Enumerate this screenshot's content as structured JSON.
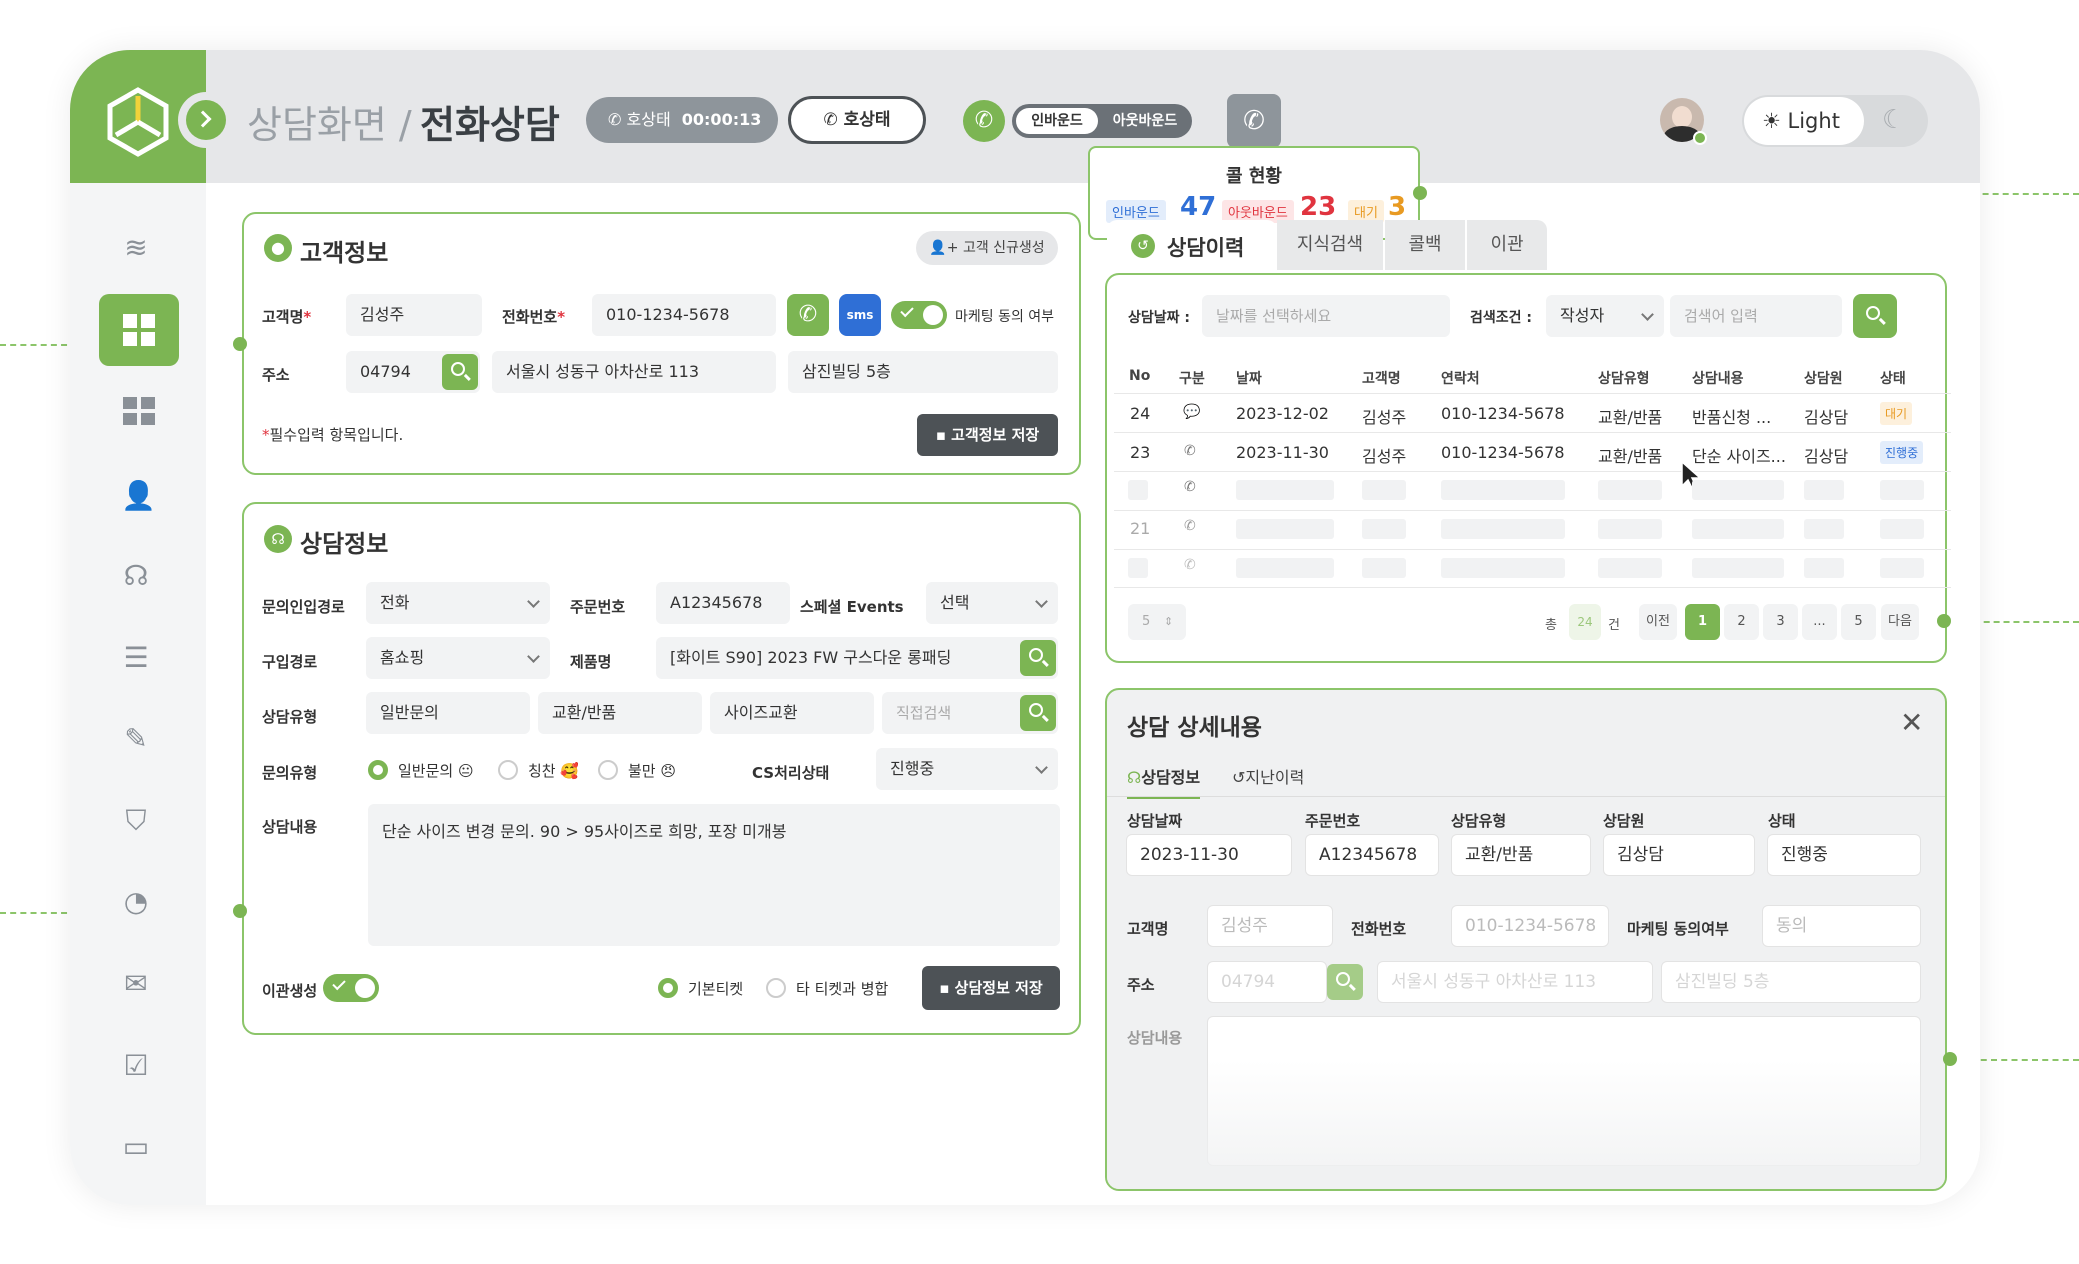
{
  "header": {
    "breadcrumb_parent": "상담화면 /",
    "breadcrumb_current": "전화상담",
    "call_state_label": "호상태",
    "call_timer": "00:00:13",
    "call_button_label": "호상태",
    "inbound_toggle": "인바운드",
    "outbound_toggle": "아웃바운드",
    "theme_light": "Light"
  },
  "call_status": {
    "title": "콜 현황",
    "inbound_label": "인바운드",
    "inbound_count": "47",
    "outbound_label": "아웃바운드",
    "outbound_count": "23",
    "waiting_label": "대기",
    "waiting_count": "3"
  },
  "customer": {
    "title": "고객정보",
    "new_button": "고객 신규생성",
    "name_label": "고객명",
    "name_value": "김성주",
    "phone_label": "전화번호",
    "phone_value": "010-1234-5678",
    "sms_label": "sms",
    "marketing_label": "마케팅 동의 여부",
    "address_label": "주소",
    "zip_value": "04794",
    "address_value": "서울시 성동구 아차산로 113",
    "address_detail": "삼진빌딩 5층",
    "required_note": "필수입력 항목입니다.",
    "save_button": "고객정보 저장"
  },
  "consult": {
    "title": "상담정보",
    "inquiry_path_label": "문의인입경로",
    "inquiry_path_value": "전화",
    "order_no_label": "주문번호",
    "order_no_value": "A12345678",
    "special_label": "스페셜 Events",
    "special_value": "선택",
    "purchase_path_label": "구입경로",
    "purchase_path_value": "홈쇼핑",
    "product_label": "제품명",
    "product_value": "[화이트 S90] 2023 FW 구스다운 롱패딩",
    "type_label": "상담유형",
    "type_1": "일반문의",
    "type_2": "교환/반품",
    "type_3": "사이즈교환",
    "type_search_placeholder": "직접검색",
    "inquiry_type_label": "문의유형",
    "radio_general": "일반문의 😐",
    "radio_praise": "칭찬 🥰",
    "radio_complaint": "불만 😠",
    "cs_state_label": "CS처리상태",
    "cs_state_value": "진행중",
    "content_label": "상담내용",
    "content_value": "단순 사이즈 변경 문의. 90 > 95사이즈로 희망, 포장 미개봉",
    "transfer_label": "이관생성",
    "radio_basic_ticket": "기본티켓",
    "radio_merge_ticket": "타 티켓과 병합",
    "save_button": "상담정보 저장"
  },
  "tabs": [
    "상담이력",
    "지식검색",
    "콜백",
    "이관"
  ],
  "history": {
    "date_label": "상담날짜 :",
    "date_placeholder": "날짜를 선택하세요",
    "search_cond_label": "검색조건 :",
    "search_cond_value": "작성자",
    "search_placeholder": "검색어 입력",
    "columns": [
      "No",
      "구분",
      "날짜",
      "고객명",
      "연락처",
      "상담유형",
      "상담내용",
      "상담원",
      "상태"
    ],
    "rows": [
      {
        "no": "24",
        "date": "2023-12-02",
        "name": "김성주",
        "phone": "010-1234-5678",
        "type": "교환/반품",
        "content": "반품신청 ...",
        "agent": "김상담",
        "status": "대기"
      },
      {
        "no": "23",
        "date": "2023-11-30",
        "name": "김성주",
        "phone": "010-1234-5678",
        "type": "교환/반품",
        "content": "단순 사이즈...",
        "agent": "김상담",
        "status": "진행중"
      },
      {
        "no": "21"
      }
    ],
    "page_size": "5",
    "total_prefix": "총",
    "total_count": "24",
    "total_suffix": "건",
    "prev": "이전",
    "pages": [
      "1",
      "2",
      "3",
      "...",
      "5"
    ],
    "next": "다음"
  },
  "detail": {
    "title": "상담 상세내용",
    "tab_info": "상담정보",
    "tab_history": "지난이력",
    "date_label": "상담날짜",
    "date_value": "2023-11-30",
    "order_label": "주문번호",
    "order_value": "A12345678",
    "type_label": "상담유형",
    "type_value": "교환/반품",
    "agent_label": "상담원",
    "agent_value": "김상담",
    "status_label": "상태",
    "status_value": "진행중",
    "name_label": "고객명",
    "name_value": "김성주",
    "phone_label": "전화번호",
    "phone_value": "010-1234-5678",
    "marketing_label": "마케팅 동의여부",
    "marketing_value": "동의",
    "address_label": "주소",
    "zip_value": "04794",
    "address_value": "서울시 성동구 아차산로 113",
    "address_detail": "삼진빌딩 5층",
    "content_label": "상담내용"
  },
  "colors": {
    "accent": "#7cb553",
    "inbound": "#2f6fd6",
    "outbound": "#e0343f",
    "waiting": "#e89a22"
  }
}
